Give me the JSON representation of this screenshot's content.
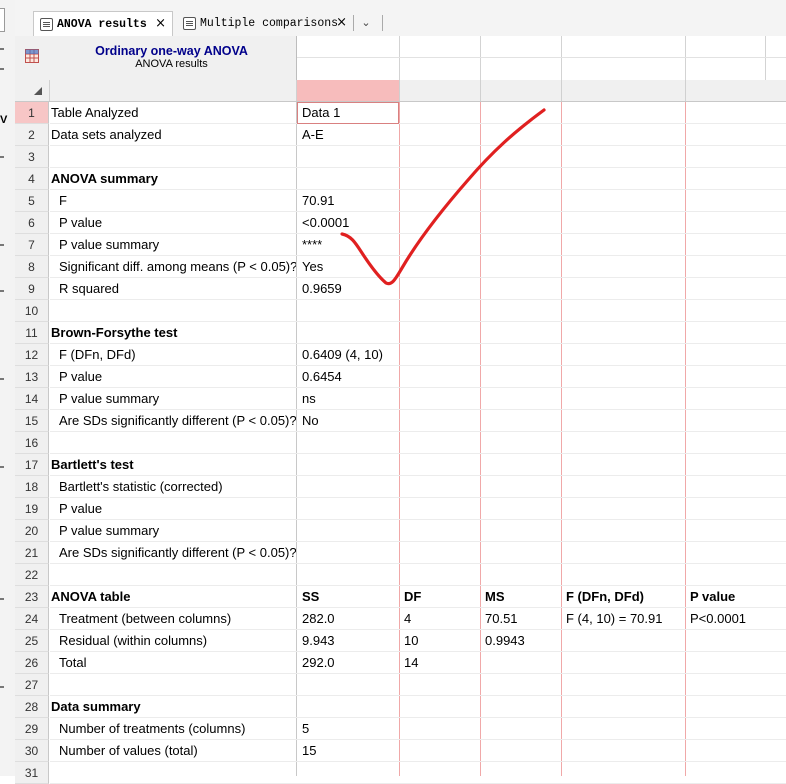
{
  "tabs": [
    {
      "label": "ANOVA results",
      "active": true
    },
    {
      "label": "Multiple comparisons",
      "active": false
    }
  ],
  "side_label": "V",
  "result_header": {
    "title": "Ordinary one-way ANOVA",
    "subtitle": "ANOVA results"
  },
  "rows": [
    {
      "num": "1",
      "title": "Table Analyzed",
      "A": "Data 1"
    },
    {
      "num": "2",
      "title": "Data sets analyzed",
      "A": "A-E"
    },
    {
      "num": "3",
      "title": ""
    },
    {
      "num": "4",
      "title": "ANOVA summary",
      "bold": true
    },
    {
      "num": "5",
      "title": "F",
      "indent": true,
      "A": "70.91"
    },
    {
      "num": "6",
      "title": "P value",
      "indent": true,
      "A": "<0.0001"
    },
    {
      "num": "7",
      "title": "P value summary",
      "indent": true,
      "A": "****"
    },
    {
      "num": "8",
      "title": "Significant diff. among means (P < 0.05)?",
      "indent": true,
      "A": "Yes"
    },
    {
      "num": "9",
      "title": "R squared",
      "indent": true,
      "A": "0.9659"
    },
    {
      "num": "10",
      "title": ""
    },
    {
      "num": "11",
      "title": "Brown-Forsythe test",
      "bold": true
    },
    {
      "num": "12",
      "title": "F (DFn, DFd)",
      "indent": true,
      "A": "0.6409 (4, 10)"
    },
    {
      "num": "13",
      "title": "P value",
      "indent": true,
      "A": "0.6454"
    },
    {
      "num": "14",
      "title": "P value summary",
      "indent": true,
      "A": "ns"
    },
    {
      "num": "15",
      "title": "Are SDs significantly different (P < 0.05)?",
      "indent": true,
      "A": "No"
    },
    {
      "num": "16",
      "title": ""
    },
    {
      "num": "17",
      "title": "Bartlett's test",
      "bold": true
    },
    {
      "num": "18",
      "title": "Bartlett's statistic (corrected)",
      "indent": true
    },
    {
      "num": "19",
      "title": "P value",
      "indent": true
    },
    {
      "num": "20",
      "title": "P value summary",
      "indent": true
    },
    {
      "num": "21",
      "title": "Are SDs significantly different (P < 0.05)?",
      "indent": true
    },
    {
      "num": "22",
      "title": ""
    },
    {
      "num": "23",
      "title": "ANOVA table",
      "bold": true,
      "A": "SS",
      "B": "DF",
      "C": "MS",
      "D": "F (DFn, DFd)",
      "E": "P value",
      "header": true
    },
    {
      "num": "24",
      "title": "Treatment (between columns)",
      "indent": true,
      "A": "282.0",
      "B": "4",
      "C": "70.51",
      "D": "F (4, 10) = 70.91",
      "E": "P<0.0001"
    },
    {
      "num": "25",
      "title": "Residual (within columns)",
      "indent": true,
      "A": "9.943",
      "B": "10",
      "C": "0.9943"
    },
    {
      "num": "26",
      "title": "Total",
      "indent": true,
      "A": "292.0",
      "B": "14"
    },
    {
      "num": "27",
      "title": ""
    },
    {
      "num": "28",
      "title": "Data summary",
      "bold": true
    },
    {
      "num": "29",
      "title": "Number of treatments (columns)",
      "indent": true,
      "A": "5"
    },
    {
      "num": "30",
      "title": "Number of values (total)",
      "indent": true,
      "A": "15"
    },
    {
      "num": "31",
      "title": ""
    }
  ],
  "colors": {
    "selection_red": "#f7bcbc",
    "header_navy": "#00008b",
    "annotation_red": "#e02020"
  }
}
